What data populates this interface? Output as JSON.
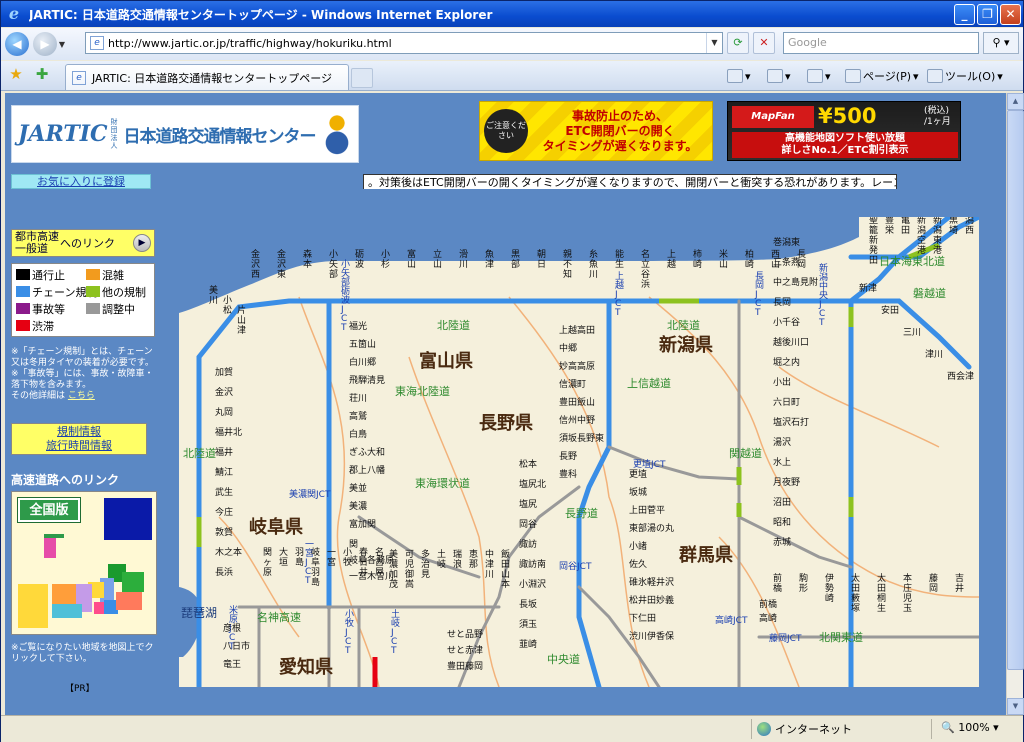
{
  "window": {
    "title": "JARTIC: 日本道路交通情報センタートップページ - Windows Internet Explorer",
    "controls": [
      "_",
      "❐",
      "✕"
    ]
  },
  "address_bar": {
    "url": "http://www.jartic.or.jp/traffic/highway/hokuriku.html",
    "search_placeholder": "Google"
  },
  "tabs": [
    {
      "label": "JARTIC: 日本道路交通情報センタートップページ"
    }
  ],
  "command_bar": {
    "page_label": "ページ(P)",
    "tools_label": "ツール(O)"
  },
  "status_bar": {
    "zone": "インターネット",
    "zoom": "100%"
  },
  "header": {
    "logo_main": "JARTIC",
    "logo_small": "財団法人",
    "logo_name": "日本道路交通情報センター",
    "banner1_caution": "ご注意ください",
    "banner1_text": [
      "事故防止のため、",
      "ETC開閉バーの開く",
      "タイミングが遅くなります。"
    ],
    "banner2_brand": "MapFan PLANER",
    "banner2_price": "¥500",
    "banner2_tax": "(税込)",
    "banner2_per": "/1ヶ月",
    "banner2_sub": [
      "高機能地図ソフト使い放題",
      "詳しさNo.1／ETC割引表示"
    ]
  },
  "favorites_link": "お気に入りに登録",
  "ticker": "。対策後はETC開閉バーの開くタイミングが遅くなりますので、開閉バーと衝突する恐れがあります。レーン",
  "sidebar": {
    "urban_title": "都市高速一般道",
    "urban_link": "へのリンク",
    "legend": [
      {
        "label": "通行止",
        "color": "#000000"
      },
      {
        "label": "混雑",
        "color": "#f29b1e"
      },
      {
        "label": "チェーン規制",
        "color": "#3a8ee6"
      },
      {
        "label": "他の規制",
        "color": "#8dc21f"
      },
      {
        "label": "事故等",
        "color": "#8b1a8b"
      },
      {
        "label": "調整中",
        "color": "#999999"
      },
      {
        "label": "渋滞",
        "color": "#e60012"
      }
    ],
    "note1": "※「チェーン規制」とは、チェーン又は冬用タイヤの装着が必要です。",
    "note2": "※「事故等」には、事故・故障車・落下物を含みます。",
    "note3": "その他詳細は",
    "note3_link": "こちら",
    "kisei_link": "規制情報",
    "time_link": "旅行時間情報",
    "hw_title": "高速道路へのリンク",
    "national": "全国版",
    "map_note": "※ご覧になりたい地域を地図上でクリックして下さい。",
    "pr": "【PR】"
  },
  "map": {
    "prefectures": [
      "富山県",
      "長野県",
      "新潟県",
      "岐阜県",
      "群馬県",
      "愛知県"
    ],
    "roads": [
      "北陸道",
      "東海北陸道",
      "上信越道",
      "関越道",
      "長野道",
      "中央道",
      "名神高速",
      "北関東道",
      "磐越道",
      "日本海東北道",
      "東海環状道",
      "北陸道",
      "北陸道"
    ],
    "lakes": [
      "琵琶湖"
    ],
    "jct": [
      "小矢部砺波JCT",
      "上越JCT",
      "長岡JCT",
      "新潟中央JCT",
      "美濃関JCT",
      "一宮JCT",
      "米原JCT",
      "小牧JCT",
      "土岐JCT",
      "岡谷JCT",
      "更埴JCT",
      "高崎JCT",
      "藤岡JCT"
    ],
    "hokuriku_ic": [
      "金沢西",
      "金沢東",
      "森本",
      "小矢部",
      "砺波",
      "小杉",
      "富山",
      "立山",
      "滑川",
      "魚津",
      "黒部",
      "朝日",
      "親不知",
      "糸魚川",
      "能生",
      "名立谷浜",
      "上越",
      "柿崎",
      "米山",
      "柏崎",
      "西山",
      "長岡",
      "美川",
      "小松",
      "片山津",
      "加賀",
      "金沢",
      "丸岡",
      "福井北",
      "福井",
      "鯖江",
      "武生",
      "今庄",
      "敦賀",
      "木之本",
      "長浜"
    ],
    "tokaihokuriku_ic": [
      "福光",
      "五箇山",
      "白川郷",
      "飛騨清見",
      "荘川",
      "高鷲",
      "白鳥",
      "ぎふ大和",
      "郡上八幡",
      "美並",
      "美濃",
      "富加関",
      "関",
      "岐阜各務原",
      "一宮木曽川",
      "美濃加茂",
      "可児御嵩",
      "多治見",
      "土岐",
      "瑞浪",
      "恵那",
      "中津川",
      "飯田山本"
    ],
    "nagano_ic": [
      "上越高田",
      "中郷",
      "妙高高原",
      "信濃町",
      "豊田飯山",
      "信州中野",
      "須坂長野東",
      "長野",
      "豊科",
      "松本",
      "塩尻北",
      "塩尻",
      "岡谷",
      "諏訪",
      "諏訪南",
      "小淵沢",
      "長坂",
      "須玉",
      "韮崎",
      "更埴",
      "坂城",
      "上田菅平",
      "東部湯の丸",
      "小諸",
      "佐久",
      "碓氷軽井沢",
      "松井田妙義",
      "下仁田",
      "渋川伊香保",
      "前橋",
      "高崎"
    ],
    "niigata_ic": [
      "巻潟東",
      "三条燕",
      "中之島見附",
      "長岡",
      "小千谷",
      "越後川口",
      "堀之内",
      "小出",
      "六日町",
      "塩沢石打",
      "湯沢",
      "水上",
      "月夜野",
      "沼田",
      "昭和",
      "赤城",
      "新津",
      "安田",
      "三川",
      "津川",
      "西会津",
      "聖籠新発田",
      "豊栄",
      "亀田",
      "新潟空港",
      "新潟東港",
      "黒埼",
      "潟西",
      "前橋",
      "駒形",
      "伊勢崎",
      "太田藪塚",
      "太田桐生",
      "本庄児玉",
      "藤岡",
      "吉井",
      "富岡"
    ],
    "aichi_ic": [
      "彦根",
      "八日市",
      "竜王",
      "関ヶ原",
      "大垣",
      "羽島",
      "岐阜羽島",
      "一宮",
      "小牧",
      "春日井",
      "名古屋",
      "せと品野",
      "せと赤津",
      "豊田藤岡"
    ]
  }
}
